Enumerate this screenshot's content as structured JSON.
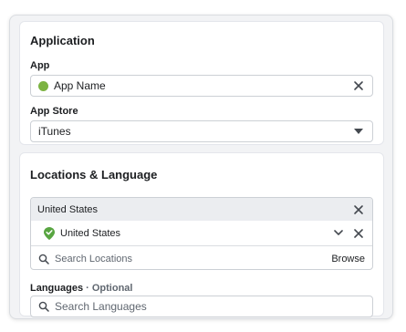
{
  "application": {
    "title": "Application",
    "app_label": "App",
    "app_value": "App Name",
    "store_label": "App Store",
    "store_value": "iTunes"
  },
  "locations": {
    "title": "Locations & Language",
    "group_title": "United States",
    "selected": "United States",
    "search_placeholder": "Search Locations",
    "browse": "Browse"
  },
  "languages": {
    "label_main": "Languages",
    "label_sep": " · ",
    "label_optional": "Optional",
    "search_placeholder": "Search Languages"
  },
  "colors": {
    "app_dot": "#7cb342",
    "location_pin": "#58a541"
  },
  "icons": {
    "app_clear": "close-icon",
    "store_dropdown": "caret-down-icon",
    "location_pin": "location-check-icon",
    "location_expand": "chevron-down-icon",
    "search": "search-icon"
  }
}
